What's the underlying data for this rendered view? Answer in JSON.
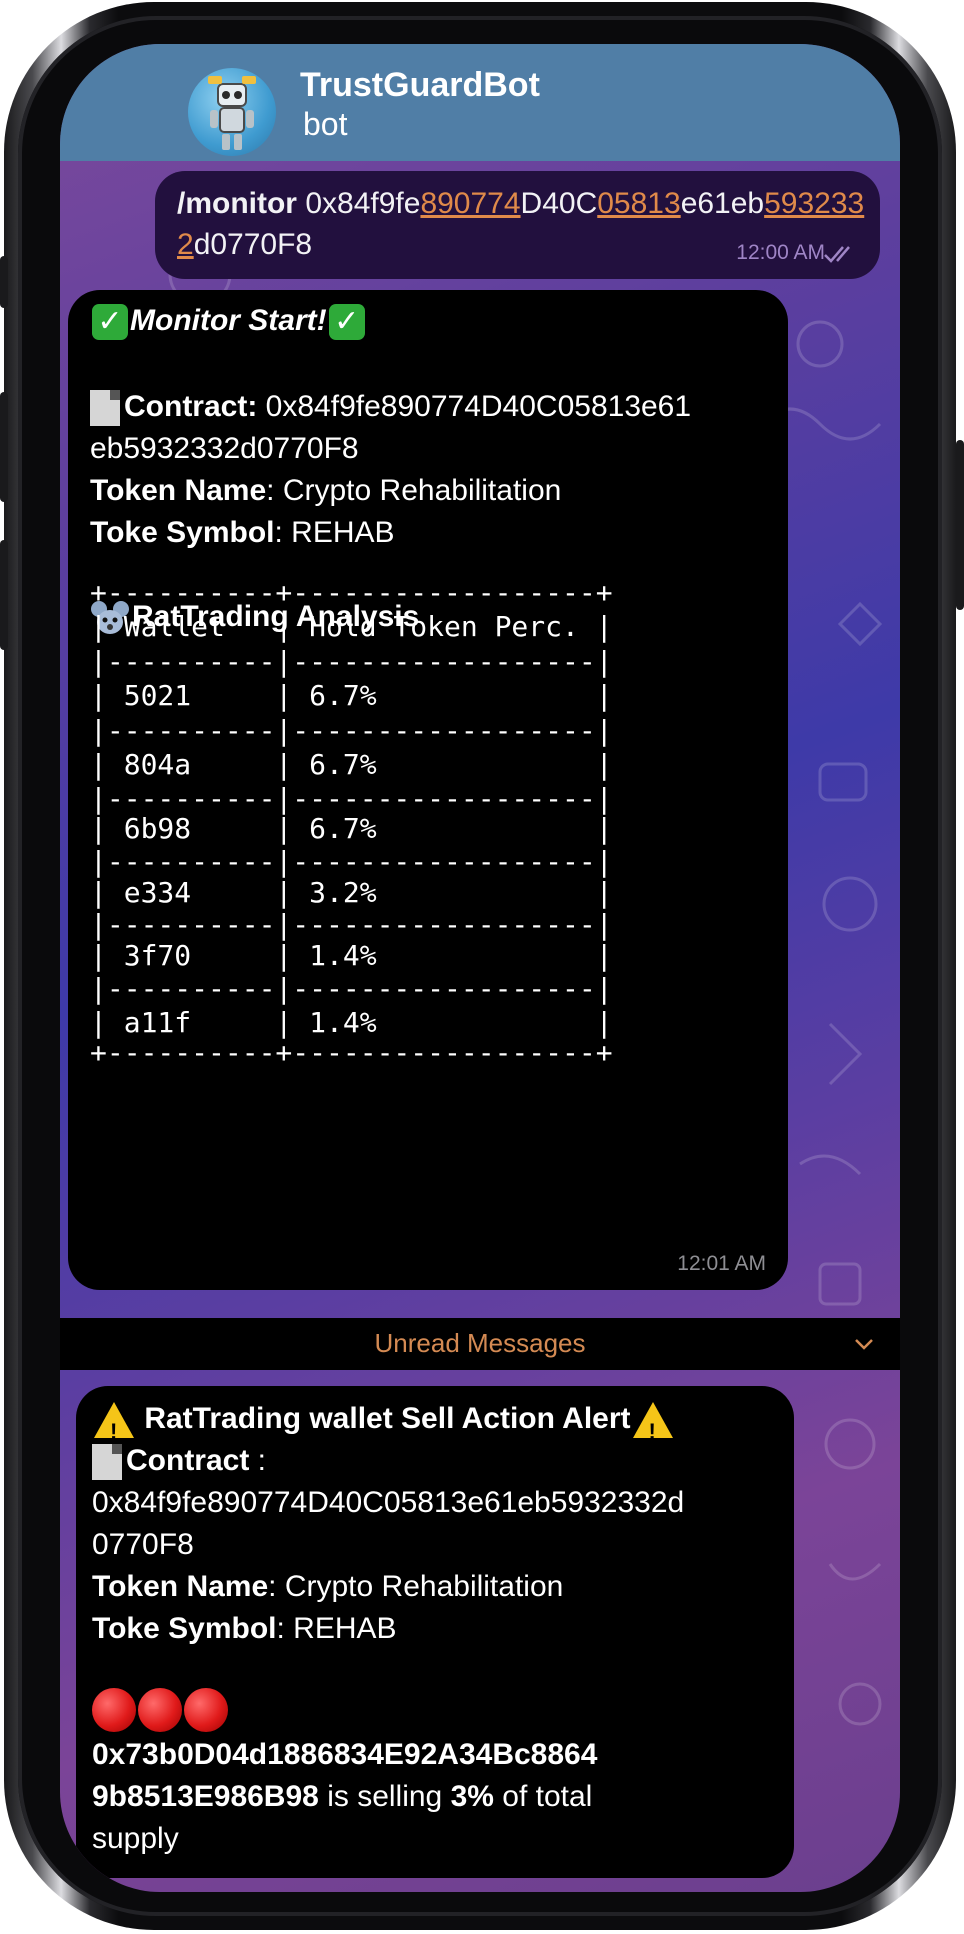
{
  "chat": {
    "title": "TrustGuardBot",
    "subtitle": "bot",
    "avatar_icon": "robot-avatar-icon"
  },
  "outgoing": {
    "command": "/monitor",
    "segments": [
      {
        "text": " 0x84f9fe",
        "link": false
      },
      {
        "text": "890774",
        "link": true
      },
      {
        "text": "D40C",
        "link": false
      },
      {
        "text": "05813",
        "link": true
      },
      {
        "text": "e61eb",
        "link": false
      },
      {
        "text": "5932332",
        "link": true
      },
      {
        "text": "d0770F8",
        "link": false
      }
    ],
    "time": "12:00 AM",
    "status": "read"
  },
  "message1": {
    "title": "Monitor Start!",
    "contract_label": "Contract:",
    "contract_line1": " 0x84f9fe890774D40C05813e61",
    "contract_line2": "eb5932332d0770F8",
    "token_name_label": "Token Name",
    "token_name_value": ": Crypto Rehabilitation",
    "symbol_label": "Toke Symbol",
    "symbol_value": ": REHAB",
    "analysis_title": "RatTrading Analysis",
    "table_border": "+----------+------------------+",
    "table_divider": "|----------|------------------|",
    "table_header": "| Wallet   | Hold Token Perc. |",
    "rows": [
      "| 5021     | 6.7%             |",
      "| 804a     | 6.7%             |",
      "| 6b98     | 6.7%             |",
      "| e334     | 3.2%             |",
      "| 3f70     | 1.4%             |",
      "| a11f     | 1.4%             |"
    ],
    "time": "12:01 AM"
  },
  "divider": {
    "label": "Unread Messages"
  },
  "message2": {
    "title": " RatTrading wallet Sell Action Alert",
    "contract_label": "Contract",
    "contract_colon": " :",
    "contract_line1": "0x84f9fe890774D40C05813e61eb5932332d",
    "contract_line2": "0770F8",
    "token_name_label": "Token Name",
    "token_name_value": ": Crypto Rehabilitation",
    "symbol_label": "Toke Symbol",
    "symbol_value": ": REHAB",
    "wallet_line1": "0x73b0D04d1886834E92A34Bc8864",
    "wallet_line2_bold": "9b8513E986B98",
    "selling_text": " is selling ",
    "percent": "3%",
    "tail_text": " of total",
    "supply_text": "supply"
  },
  "colors": {
    "header": "#507ea6",
    "outgoing_bubble": "#22103e",
    "incoming_bubble": "#000000",
    "link": "#e08a4a",
    "unread_label": "#d48a53"
  }
}
